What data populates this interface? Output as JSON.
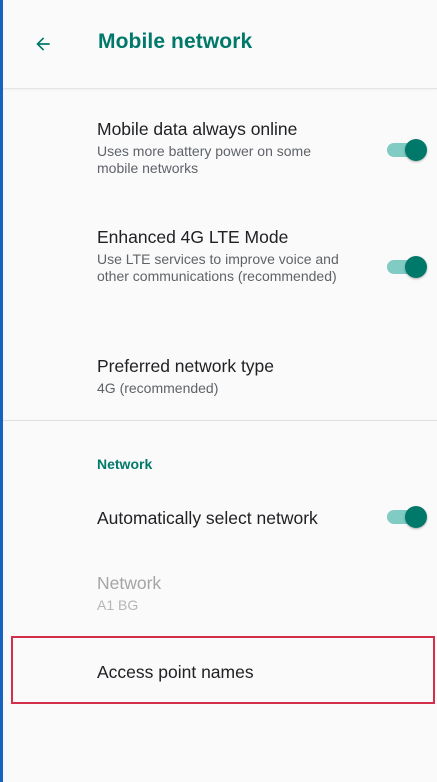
{
  "header": {
    "back_icon": "arrow-back-icon",
    "title": "Mobile network"
  },
  "settings": {
    "mobile_data_always_online": {
      "title": "Mobile data always online",
      "summary": "Uses more battery power on some mobile networks",
      "enabled": true
    },
    "enhanced_4g_lte": {
      "title": "Enhanced 4G LTE Mode",
      "summary": "Use LTE services to improve voice and other communications (recommended)",
      "enabled": true
    },
    "preferred_network_type": {
      "title": "Preferred network type",
      "summary": "4G (recommended)"
    }
  },
  "network_section": {
    "header": "Network",
    "auto_select": {
      "title": "Automatically select network",
      "enabled": true
    },
    "network": {
      "title": "Network",
      "summary": "A1 BG",
      "disabled": true
    },
    "access_point_names": {
      "title": "Access point names"
    }
  },
  "colors": {
    "accent": "#00796b",
    "switch_track": "#80cbc4",
    "highlight_border": "#d32f4b",
    "left_edge": "#1565c0"
  }
}
